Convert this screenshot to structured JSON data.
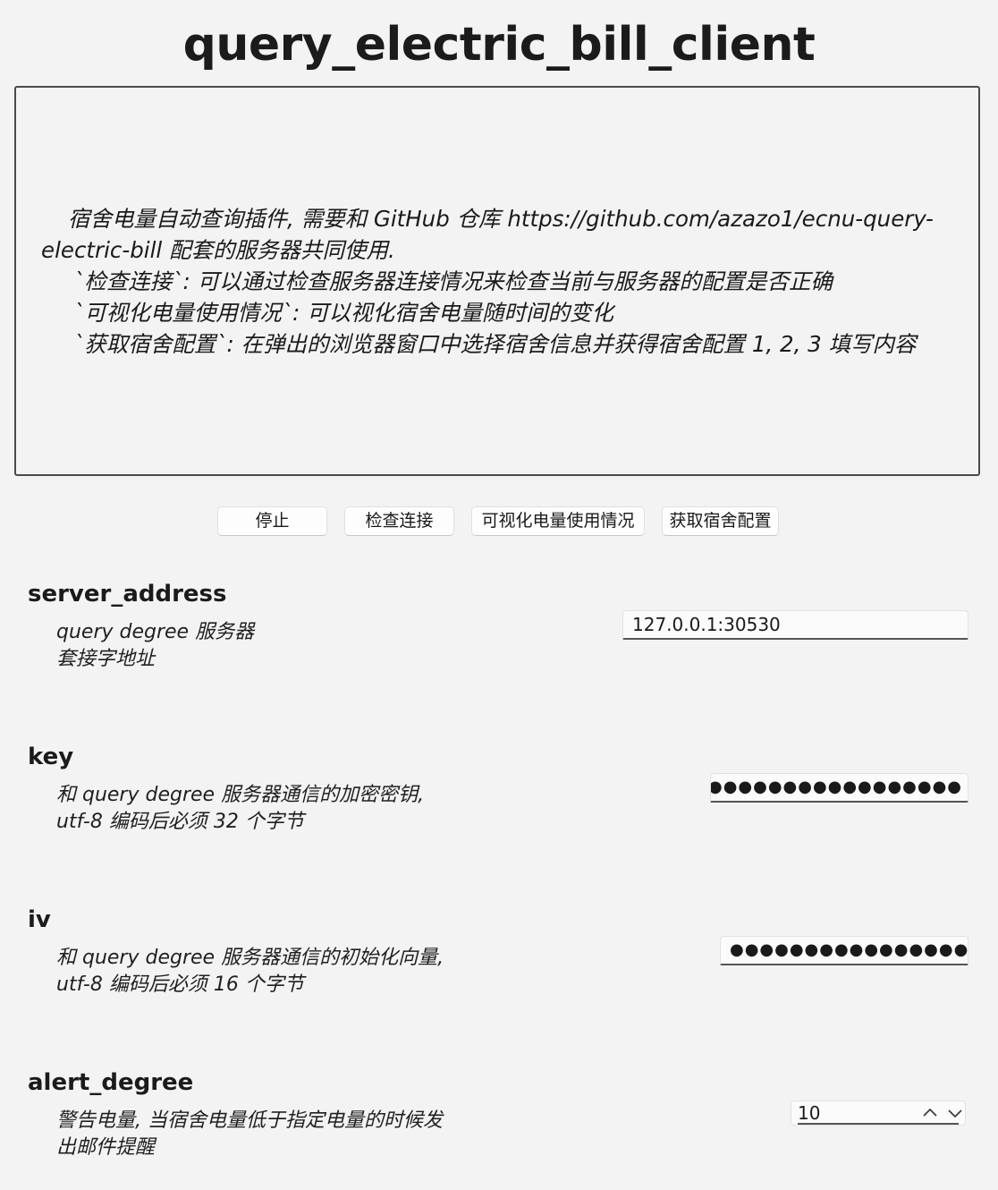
{
  "app": {
    "title": "query_electric_bill_client"
  },
  "description": {
    "line1": "宿舍电量自动查询插件, 需要和 GitHub 仓库 https://github.com/azazo1/ecnu-query-electric-bill 配套的服务器共同使用.",
    "line2": "`检查连接`: 可以通过检查服务器连接情况来检查当前与服务器的配置是否正确",
    "line3": "`可视化电量使用情况`: 可以视化宿舍电量随时间的变化",
    "line4": "`获取宿舍配置`: 在弹出的浏览器窗口中选择宿舍信息并获得宿舍配置 1, 2, 3 填写内容"
  },
  "buttons": {
    "stop": "停止",
    "check_connection": "检查连接",
    "visualize": "可视化电量使用情况",
    "get_dorm_config": "获取宿舍配置"
  },
  "settings": {
    "server_address": {
      "name": "server_address",
      "desc_line1": "query degree 服务器",
      "desc_line2": "套接字地址",
      "value": "127.0.0.1:30530"
    },
    "key": {
      "name": "key",
      "desc_line1": "和 query degree 服务器通信的加密密钥,",
      "desc_line2": "utf-8 编码后必须 32 个字节",
      "masked_value": "●●●●●●●●●●●●●●●●●●●●●"
    },
    "iv": {
      "name": "iv",
      "desc_line1": "和 query degree 服务器通信的初始化向量,",
      "desc_line2": "utf-8 编码后必须 16 个字节",
      "masked_value": "●●●●●●●●●●●●●●●●●"
    },
    "alert_degree": {
      "name": "alert_degree",
      "desc_line1": "警告电量, 当宿舍电量低于指定电量的时候发",
      "desc_line2": "出邮件提醒",
      "value": "10",
      "increment_icon": "chevron-up-icon",
      "decrement_icon": "chevron-down-icon"
    }
  }
}
